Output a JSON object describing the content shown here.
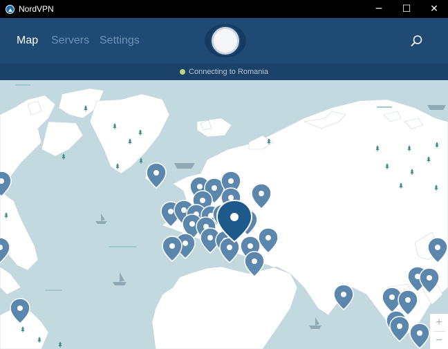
{
  "window": {
    "title": "NordVPN",
    "minimize": "─",
    "maximize": "☐",
    "close": "✕"
  },
  "nav": {
    "tabs": [
      {
        "label": "Map"
      },
      {
        "label": "Servers"
      },
      {
        "label": "Settings"
      }
    ]
  },
  "status": {
    "text": "Connecting to Romania",
    "dot_color": "#b9d67a"
  },
  "map": {
    "zoom_in": "+",
    "zoom_out": "−",
    "colors": {
      "sea": "#c3d9e0",
      "land": "#ffffff",
      "pin": "#5b87ad",
      "pin_active": "#1f5a8c"
    }
  },
  "icons": [
    "app-logo-icon",
    "search-icon",
    "power-icon",
    "location-pin-icon",
    "ship-icon",
    "sailboat-icon",
    "tree-icon",
    "wave-icon"
  ]
}
